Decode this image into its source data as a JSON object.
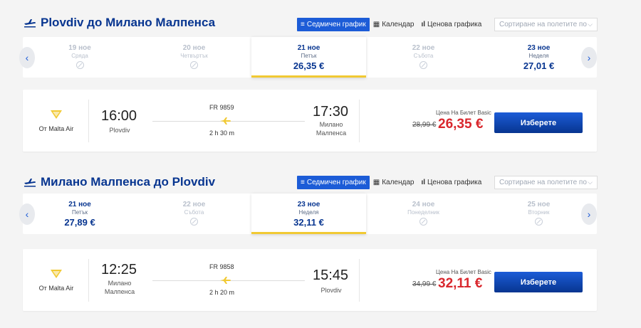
{
  "colors": {
    "brand": "#073590",
    "accent": "#1c5cd7",
    "price_red": "#d9272d",
    "selected_underline": "#f1c933"
  },
  "outbound": {
    "title": "Plovdiv до Милано Малпенса",
    "tabs": [
      {
        "label": "Седмичен график",
        "icon": "list-icon",
        "active": true
      },
      {
        "label": "Календар",
        "icon": "calendar-icon",
        "active": false
      },
      {
        "label": "Ценова графика",
        "icon": "bar-chart-icon",
        "active": false
      }
    ],
    "sort_placeholder": "Сортиране на полетите по",
    "dates": [
      {
        "date": "19 ное",
        "weekday": "Сряда",
        "price": "",
        "available": false,
        "selected": false
      },
      {
        "date": "20 ное",
        "weekday": "Четвъртък",
        "price": "",
        "available": false,
        "selected": false
      },
      {
        "date": "21 ное",
        "weekday": "Петък",
        "price": "26,35 €",
        "available": true,
        "selected": true
      },
      {
        "date": "22 ное",
        "weekday": "Събота",
        "price": "",
        "available": false,
        "selected": false
      },
      {
        "date": "23 ное",
        "weekday": "Неделя",
        "price": "27,01 €",
        "available": true,
        "selected": false
      }
    ],
    "flight": {
      "operator": "От Malta Air",
      "dep_time": "16:00",
      "dep_city": "Plovdiv",
      "flight_number": "FR 9859",
      "duration": "2 h 30 m",
      "arr_time": "17:30",
      "arr_city": "Милано Малпенса",
      "fare_label": "Цена На Билет Basic",
      "old_price": "28,99 €",
      "price": "26,35 €",
      "select_label": "Изберете"
    }
  },
  "return": {
    "title": "Милано Малпенса до Plovdiv",
    "tabs": [
      {
        "label": "Седмичен график",
        "icon": "list-icon",
        "active": true
      },
      {
        "label": "Календар",
        "icon": "calendar-icon",
        "active": false
      },
      {
        "label": "Ценова графика",
        "icon": "bar-chart-icon",
        "active": false
      }
    ],
    "sort_placeholder": "Сортиране на полетите по",
    "dates": [
      {
        "date": "21 ное",
        "weekday": "Петък",
        "price": "27,89 €",
        "available": true,
        "selected": false
      },
      {
        "date": "22 ное",
        "weekday": "Събота",
        "price": "",
        "available": false,
        "selected": false
      },
      {
        "date": "23 ное",
        "weekday": "Неделя",
        "price": "32,11 €",
        "available": true,
        "selected": true
      },
      {
        "date": "24 ное",
        "weekday": "Понеделник",
        "price": "",
        "available": false,
        "selected": false
      },
      {
        "date": "25 ное",
        "weekday": "Вторник",
        "price": "",
        "available": false,
        "selected": false
      }
    ],
    "flight": {
      "operator": "От Malta Air",
      "dep_time": "12:25",
      "dep_city": "Милано Малпенса",
      "flight_number": "FR 9858",
      "duration": "2 h 20 m",
      "arr_time": "15:45",
      "arr_city": "Plovdiv",
      "fare_label": "Цена На Билет Basic",
      "old_price": "34,99 €",
      "price": "32,11 €",
      "select_label": "Изберете"
    }
  }
}
